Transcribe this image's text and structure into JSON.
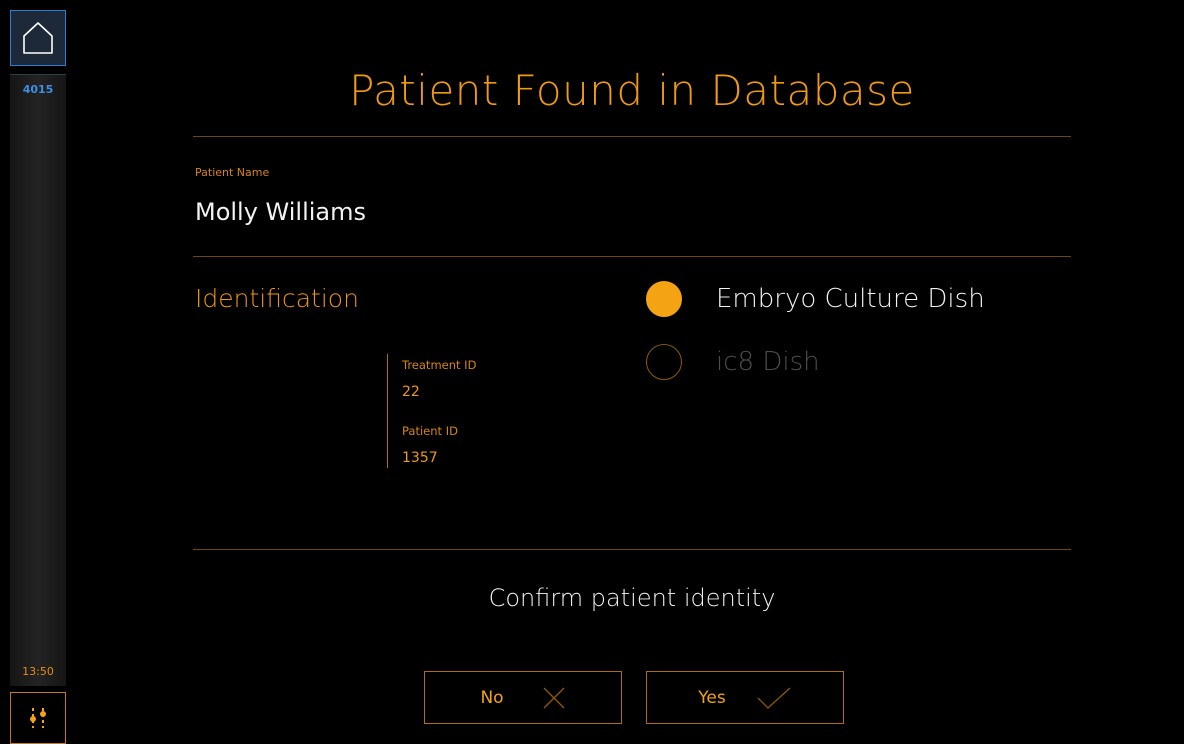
{
  "sidebar": {
    "instrument_id": "4015",
    "time": "13:50",
    "home_icon": "home-icon",
    "settings_icon": "sliders-icon"
  },
  "page": {
    "title": "Patient Found in Database"
  },
  "patient": {
    "name_label": "Patient Name",
    "name": "Molly Williams"
  },
  "identification": {
    "heading": "Identification",
    "treatment_id_label": "Treatment ID",
    "treatment_id": "22",
    "patient_id_label": "Patient ID",
    "patient_id": "1357"
  },
  "dish_options": [
    {
      "label": "Embryo Culture Dish",
      "selected": true
    },
    {
      "label": "ic8 Dish",
      "selected": false
    }
  ],
  "confirm": {
    "prompt": "Confirm patient identity",
    "no_label": "No",
    "yes_label": "Yes"
  },
  "colors": {
    "accent": "#f09a10",
    "divider": "#6e4708",
    "instrument_blue": "#3d8ee6"
  }
}
